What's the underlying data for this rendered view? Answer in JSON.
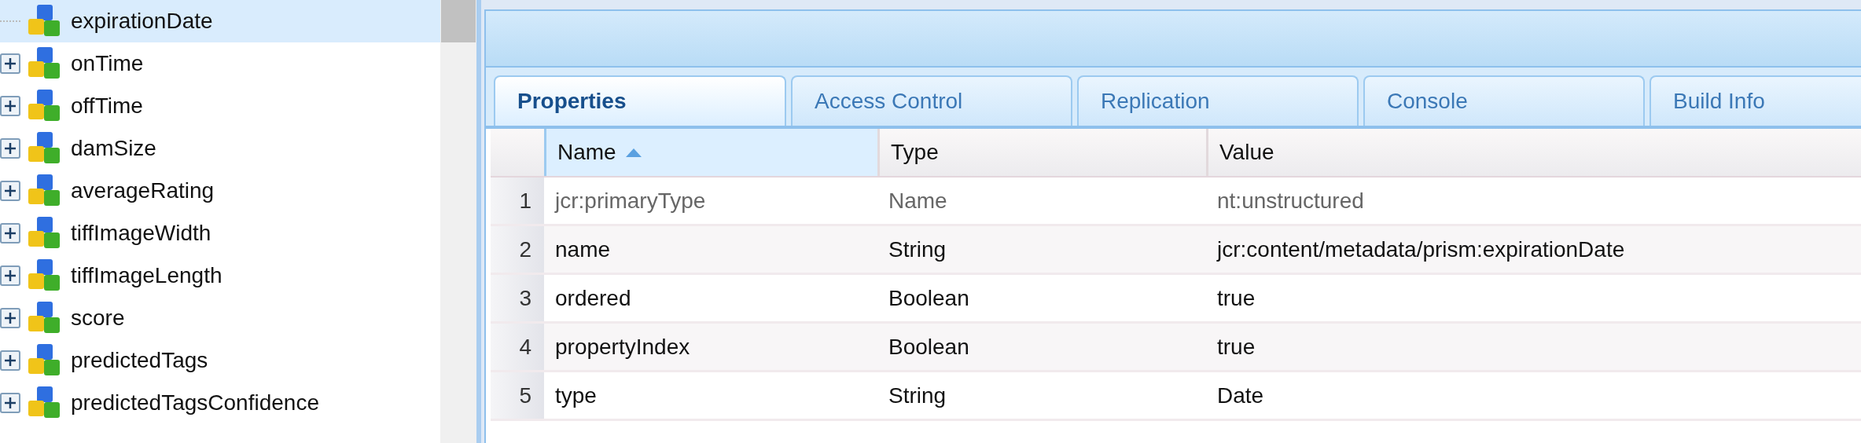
{
  "tree": {
    "items": [
      {
        "label": "expirationDate",
        "kind": "leaf",
        "selected": true
      },
      {
        "label": "onTime",
        "kind": "collapsed",
        "selected": false
      },
      {
        "label": "offTime",
        "kind": "collapsed",
        "selected": false
      },
      {
        "label": "damSize",
        "kind": "collapsed",
        "selected": false
      },
      {
        "label": "averageRating",
        "kind": "collapsed",
        "selected": false
      },
      {
        "label": "tiffImageWidth",
        "kind": "collapsed",
        "selected": false
      },
      {
        "label": "tiffImageLength",
        "kind": "collapsed",
        "selected": false
      },
      {
        "label": "score",
        "kind": "collapsed",
        "selected": false
      },
      {
        "label": "predictedTags",
        "kind": "collapsed",
        "selected": false
      },
      {
        "label": "predictedTagsConfidence",
        "kind": "collapsed",
        "selected": false
      }
    ]
  },
  "tabs": [
    {
      "label": "Properties",
      "selected": true
    },
    {
      "label": "Access Control",
      "selected": false
    },
    {
      "label": "Replication",
      "selected": false
    },
    {
      "label": "Console",
      "selected": false
    },
    {
      "label": "Build Info",
      "selected": false
    }
  ],
  "table": {
    "columns": [
      {
        "label": "Name",
        "sorted": true
      },
      {
        "label": "Type",
        "sorted": false
      },
      {
        "label": "Value",
        "sorted": false
      }
    ],
    "rows": [
      {
        "index": "1",
        "name": "jcr:primaryType",
        "type": "Name",
        "value": "nt:unstructured",
        "protected": true
      },
      {
        "index": "2",
        "name": "name",
        "type": "String",
        "value": "jcr:content/metadata/prism:expirationDate",
        "protected": false
      },
      {
        "index": "3",
        "name": "ordered",
        "type": "Boolean",
        "value": "true",
        "protected": false
      },
      {
        "index": "4",
        "name": "propertyIndex",
        "type": "Boolean",
        "value": "true",
        "protected": false
      },
      {
        "index": "5",
        "name": "type",
        "type": "String",
        "value": "Date",
        "protected": false
      }
    ]
  }
}
